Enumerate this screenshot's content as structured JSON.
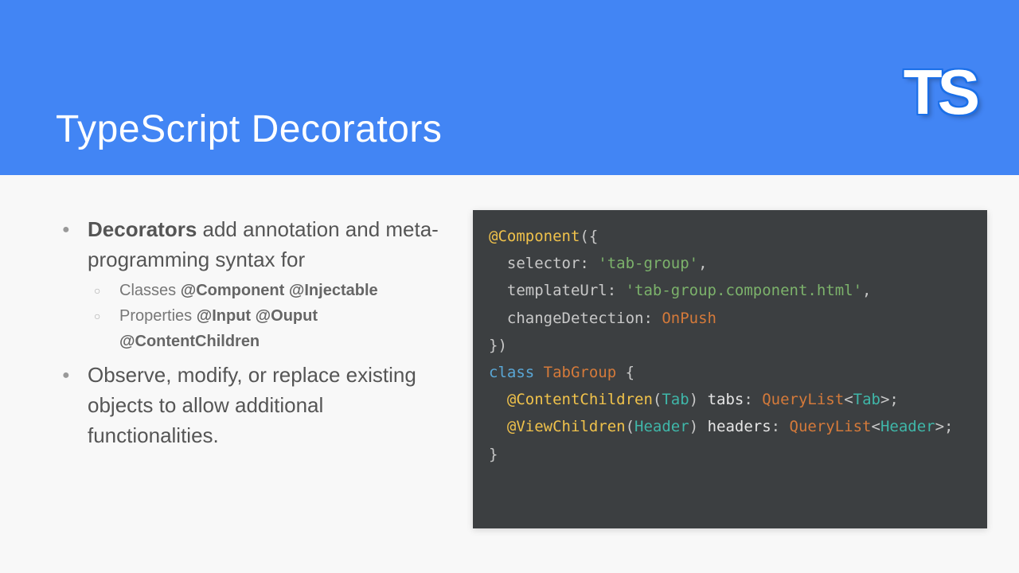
{
  "header": {
    "title": "TypeScript Decorators",
    "logo": "TS"
  },
  "bullets": {
    "item1_lead": "Decorators",
    "item1_rest": " add annotation and meta-programming syntax for",
    "sub1_lead": "Classes ",
    "sub1_d1": "@Component",
    "sub1_sp": " ",
    "sub1_d2": "@Injectable",
    "sub2_lead": "Properties ",
    "sub2_d1": "@Input",
    "sub2_sp1": " ",
    "sub2_d2": "@Ouput",
    "sub2_sp2": " ",
    "sub2_d3": "@ContentChildren",
    "item2": "Observe, modify, or replace existing objects to allow additional functionalities."
  },
  "code": {
    "l1a": "@Component",
    "l1b": "({",
    "l2a": "  selector",
    "l2b": ": ",
    "l2c": "'tab-group'",
    "l2d": ",",
    "l3a": "  templateUrl",
    "l3b": ": ",
    "l3c": "'tab-group.component.html'",
    "l3d": ",",
    "l4a": "  changeDetection",
    "l4b": ": ",
    "l4c": "OnPush",
    "l5": "})",
    "l6a": "class",
    "l6sp": " ",
    "l6b": "TabGroup",
    "l6c": " {",
    "l7a": "  @ContentChildren",
    "l7b": "(",
    "l7c": "Tab",
    "l7d": ") ",
    "l7e": "tabs",
    "l7f": ": ",
    "l7g": "QueryList",
    "l7h": "<",
    "l7i": "Tab",
    "l7j": ">;",
    "l8a": "  @ViewChildren",
    "l8b": "(",
    "l8c": "Header",
    "l8d": ") ",
    "l8e": "headers",
    "l8f": ": ",
    "l8g": "QueryList",
    "l8h": "<",
    "l8i": "Header",
    "l8j": ">;",
    "l9": "}"
  }
}
